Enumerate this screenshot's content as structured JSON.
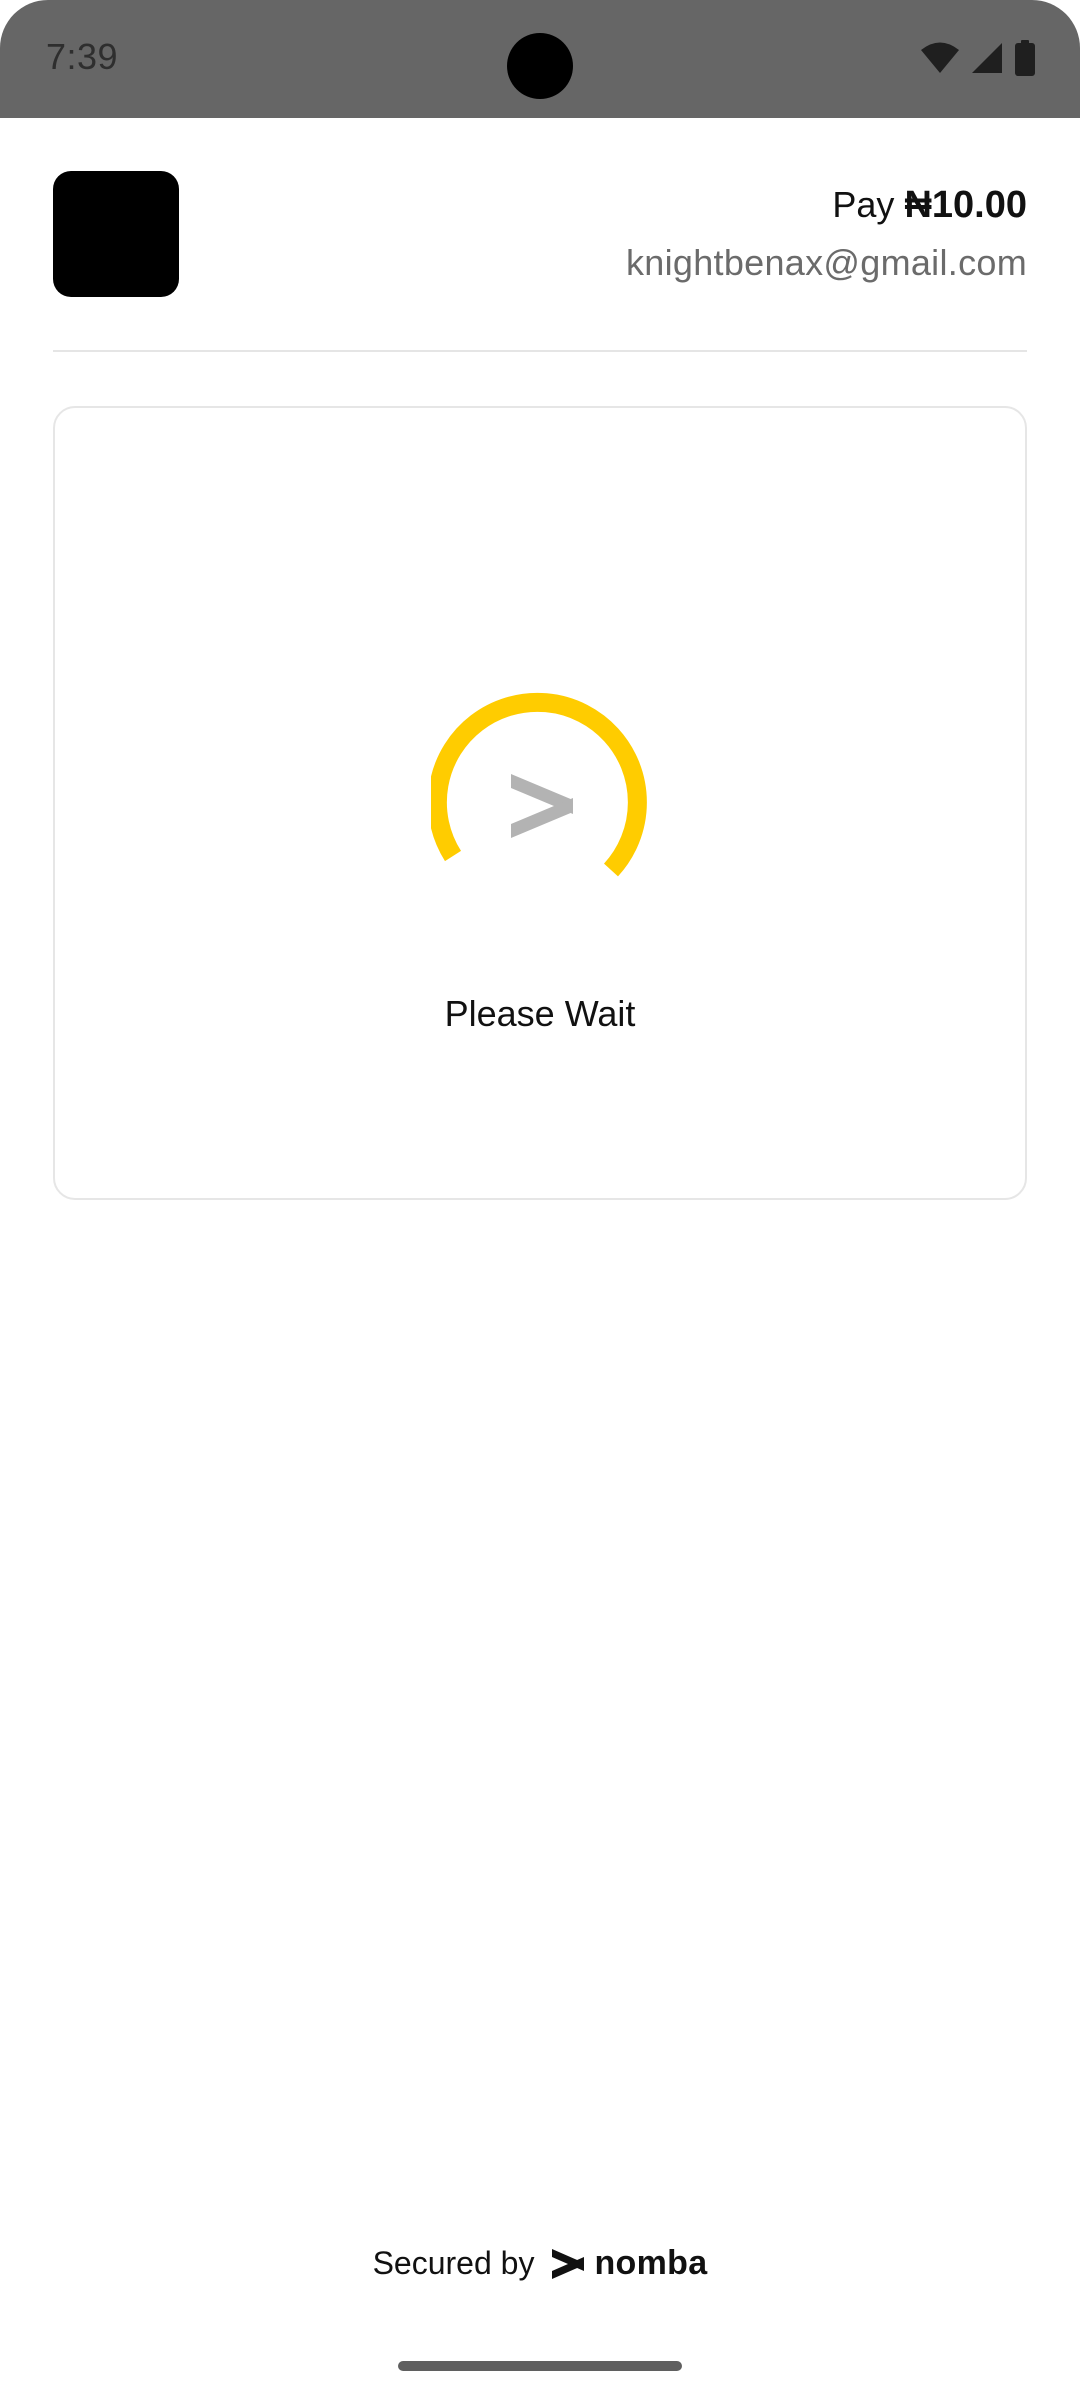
{
  "status_bar": {
    "time": "7:39",
    "icons": [
      "wifi-icon",
      "cell-signal-icon",
      "battery-icon"
    ]
  },
  "header": {
    "pay_label": "Pay",
    "amount": "₦10.00",
    "email": "knightbenax@gmail.com"
  },
  "card": {
    "message": "Please Wait",
    "spinner_icon": "nomba-logo-icon"
  },
  "footer": {
    "secured_label": "Secured by",
    "brand": "nomba"
  },
  "colors": {
    "accent": "#FFCC00",
    "status_bar": "#666666",
    "text": "#111111",
    "muted_text": "#6b6b6b"
  }
}
